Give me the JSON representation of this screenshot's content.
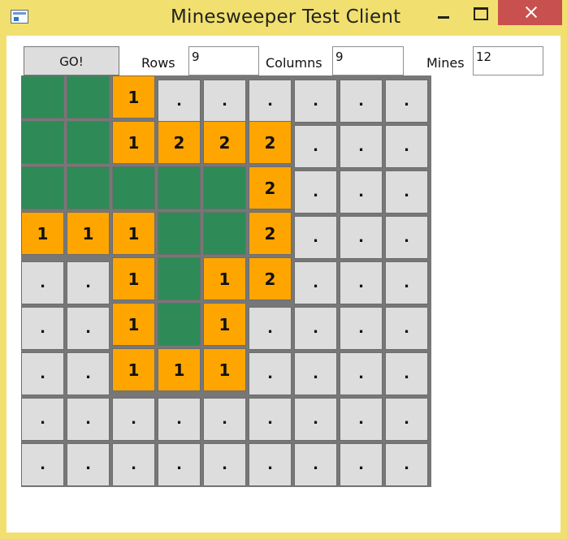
{
  "window": {
    "title": "Minesweeper Test Client"
  },
  "controls": {
    "go_label": "GO!",
    "rows_label": "Rows",
    "rows_value": "9",
    "columns_label": "Columns",
    "columns_value": "9",
    "mines_label": "Mines",
    "mines_value": "12"
  },
  "board": {
    "rows": [
      [
        "",
        "",
        "1",
        ".",
        ".",
        ".",
        ".",
        ".",
        "."
      ],
      [
        "",
        "",
        "1",
        "2",
        "2",
        "2",
        ".",
        ".",
        "."
      ],
      [
        "",
        "",
        "",
        "",
        "",
        "2",
        ".",
        ".",
        "."
      ],
      [
        "1",
        "1",
        "1",
        "",
        "",
        "2",
        ".",
        ".",
        "."
      ],
      [
        ".",
        ".",
        "1",
        "",
        "1",
        "2",
        ".",
        ".",
        "."
      ],
      [
        ".",
        ".",
        "1",
        "",
        "1",
        ".",
        ".",
        ".",
        "."
      ],
      [
        ".",
        ".",
        "1",
        "1",
        "1",
        ".",
        ".",
        ".",
        "."
      ],
      [
        ".",
        ".",
        ".",
        ".",
        ".",
        ".",
        ".",
        ".",
        "."
      ],
      [
        ".",
        ".",
        ".",
        ".",
        ".",
        ".",
        ".",
        ".",
        "."
      ]
    ]
  },
  "colors": {
    "hidden": "#dddddd",
    "empty": "#2e8b57",
    "number": "#ffa500",
    "window": "#f1e06f",
    "close": "#c8504f"
  }
}
